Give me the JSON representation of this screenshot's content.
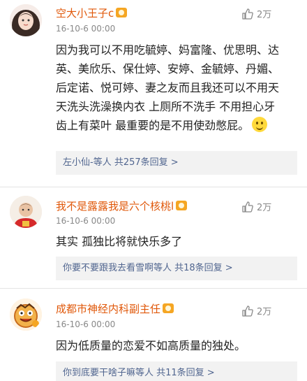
{
  "comments": [
    {
      "name": "空大小王子c",
      "time": "16-10-6 00:00",
      "likes": "2万",
      "text": "因为我可以不用吃毓婷、妈富隆、优思明、达英、美欣乐、保仕婷、安婷、金毓婷、丹媚、后定诺、悦可婷、妻之友而且我还可以不用天天洗头洗澡换内衣 上厕所不洗手 不用担心牙齿上有菜叶 最重要的是不用使劲憋屁。",
      "emoji": "smile-emoji",
      "replies": "左小仙-等人 共257条回复 >"
    },
    {
      "name": "我不是露露我是六个核桃l",
      "time": "16-10-6 00:00",
      "likes": "2万",
      "text": "其实 孤独比将就快乐多了",
      "replies": "你要不要跟我去看雪啊等人 共18条回复 >"
    },
    {
      "name": "成都市神经内科副主任",
      "time": "16-10-6 00:00",
      "likes": "2万",
      "text": "因为低质量的恋爱不如高质量的独处。",
      "replies": "你到底要干啥子嘛等人 共11条回复 >"
    }
  ]
}
